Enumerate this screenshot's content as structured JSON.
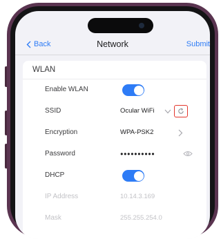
{
  "nav": {
    "back_label": "Back",
    "title": "Network",
    "submit_label": "Submit"
  },
  "wlan": {
    "section_title": "WLAN",
    "rows": [
      {
        "label": "Enable WLAN",
        "control": "toggle",
        "enabled": true
      },
      {
        "label": "SSID",
        "value": "Ocular WiFi",
        "control": "dropdown+refresh"
      },
      {
        "label": "Encryption",
        "value": "WPA-PSK2",
        "control": "chevron"
      },
      {
        "label": "Password",
        "value": "●●●●●●●●●●",
        "control": "eye"
      },
      {
        "label": "DHCP",
        "control": "toggle",
        "enabled": true
      },
      {
        "label": "IP Address",
        "value": "10.14.3.169",
        "disabled": true
      },
      {
        "label": "Mask",
        "value": "255.255.254.0",
        "disabled": true
      }
    ]
  },
  "icons": {
    "back": "chevron-left-icon",
    "ssid_dropdown": "chevron-down-icon",
    "ssid_refresh": "refresh-icon",
    "encryption_next": "chevron-right-icon",
    "password_visibility": "eye-icon"
  },
  "colors": {
    "accent": "#2e7cf6",
    "highlight_box": "#e3352b",
    "phone_frame": "#5a3450",
    "screen_bg": "#f2f2f7",
    "card_bg": "#ffffff"
  }
}
